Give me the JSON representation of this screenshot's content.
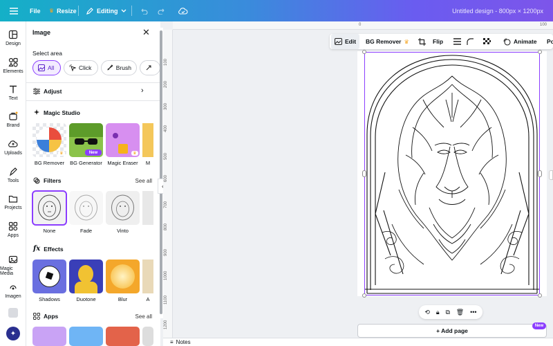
{
  "topbar": {
    "file_label": "File",
    "resize_label": "Resize",
    "editing_label": "Editing",
    "doc_title": "Untitled design - 800px × 1200px",
    "gradient_start": "#14b0c7",
    "gradient_end": "#7d55ea"
  },
  "rail": {
    "items": [
      {
        "label": "Design",
        "icon": "layout-icon"
      },
      {
        "label": "Elements",
        "icon": "shapes-icon"
      },
      {
        "label": "Text",
        "icon": "text-icon"
      },
      {
        "label": "Brand",
        "icon": "brand-icon"
      },
      {
        "label": "Uploads",
        "icon": "cloud-upload-icon"
      },
      {
        "label": "Tools",
        "icon": "pen-tool-icon"
      },
      {
        "label": "Projects",
        "icon": "folder-icon"
      },
      {
        "label": "Apps",
        "icon": "apps-icon"
      },
      {
        "label": "Magic Media",
        "icon": "magic-media-icon"
      },
      {
        "label": "Imagen",
        "icon": "imagen-icon"
      }
    ]
  },
  "panel": {
    "title": "Image",
    "select_area_label": "Select area",
    "area_options": [
      "All",
      "Click",
      "Brush"
    ],
    "adjust_label": "Adjust",
    "magic_studio_label": "Magic Studio",
    "magic_tools": [
      {
        "label": "BG Remover",
        "badge": ""
      },
      {
        "label": "BG Generator",
        "badge": "New"
      },
      {
        "label": "Magic Eraser",
        "badge": ""
      },
      {
        "label": "M",
        "badge": ""
      }
    ],
    "filters_label": "Filters",
    "filters_see_all": "See all",
    "filters": [
      {
        "label": "None",
        "selected": true
      },
      {
        "label": "Fade",
        "selected": false
      },
      {
        "label": "Vinto",
        "selected": false
      }
    ],
    "effects_label": "Effects",
    "effects": [
      {
        "label": "Shadows"
      },
      {
        "label": "Duotone"
      },
      {
        "label": "Blur"
      },
      {
        "label": "A"
      }
    ],
    "apps_label": "Apps",
    "apps_see_all": "See all"
  },
  "toolbar": {
    "edit_label": "Edit",
    "bg_remover_label": "BG Remover",
    "flip_label": "Flip",
    "animate_label": "Animate",
    "position_label": "Po"
  },
  "rulers": {
    "top": [
      "0",
      "100"
    ],
    "left": [
      "100",
      "200",
      "300",
      "400",
      "500",
      "600",
      "700",
      "800",
      "900",
      "1000",
      "1100",
      "1200"
    ]
  },
  "canvas": {
    "add_page_label": "+ Add page",
    "new_badge": "New",
    "notes_label": "Notes",
    "accent": "#8b3dff"
  }
}
